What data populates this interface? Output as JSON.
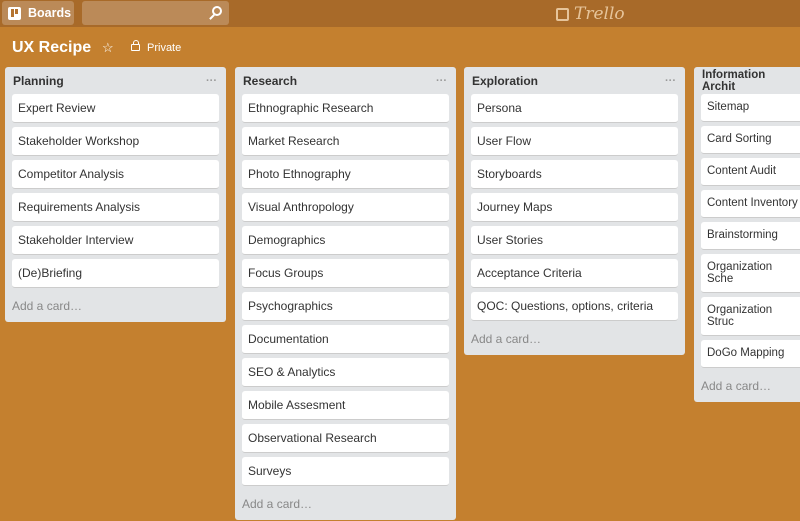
{
  "header": {
    "boards_label": "Boards",
    "logo_text": "Trello"
  },
  "board": {
    "title": "UX Recipe",
    "visibility": "Private"
  },
  "lists": [
    {
      "title": "Planning",
      "menu": "···",
      "cards": [
        "Expert Review",
        "Stakeholder Workshop",
        "Competitor Analysis",
        "Requirements Analysis",
        "Stakeholder Interview",
        "(De)Briefing"
      ],
      "add": "Add a card…"
    },
    {
      "title": "Research",
      "menu": "···",
      "cards": [
        "Ethnographic Research",
        "Market Research",
        "Photo Ethnography",
        "Visual Anthropology",
        "Demographics",
        "Focus Groups",
        "Psychographics",
        "Documentation",
        "SEO & Analytics",
        "Mobile Assesment",
        "Observational Research",
        "Surveys"
      ],
      "add": "Add a card…"
    },
    {
      "title": "Exploration",
      "menu": "···",
      "cards": [
        "Persona",
        "User Flow",
        "Storyboards",
        "Journey Maps",
        "User Stories",
        "Acceptance Criteria",
        "QOC: Questions, options, criteria"
      ],
      "add": "Add a card…"
    },
    {
      "title": "Information Archit",
      "menu": "",
      "cards": [
        "Sitemap",
        "Card Sorting",
        "Content Audit",
        "Content Inventory",
        "Brainstorming",
        "Organization Sche",
        "Organization Struc",
        "DoGo Mapping"
      ],
      "add": "Add a card…"
    }
  ]
}
